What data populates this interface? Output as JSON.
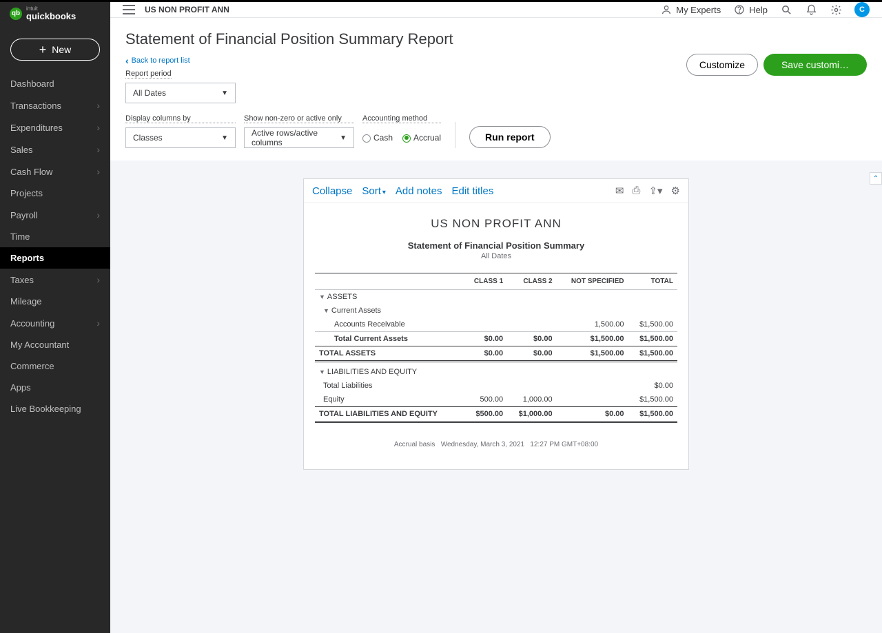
{
  "brand": {
    "intuit": "intuit",
    "product": "quickbooks",
    "logo_letter": "qb"
  },
  "new_button": "New",
  "nav": [
    {
      "label": "Dashboard",
      "chev": false
    },
    {
      "label": "Transactions",
      "chev": true
    },
    {
      "label": "Expenditures",
      "chev": true
    },
    {
      "label": "Sales",
      "chev": true
    },
    {
      "label": "Cash Flow",
      "chev": true
    },
    {
      "label": "Projects",
      "chev": false
    },
    {
      "label": "Payroll",
      "chev": true
    },
    {
      "label": "Time",
      "chev": false
    },
    {
      "label": "Reports",
      "chev": false,
      "active": true
    },
    {
      "label": "Taxes",
      "chev": true
    },
    {
      "label": "Mileage",
      "chev": false
    },
    {
      "label": "Accounting",
      "chev": true
    },
    {
      "label": "My Accountant",
      "chev": false
    },
    {
      "label": "Commerce",
      "chev": false
    },
    {
      "label": "Apps",
      "chev": false
    },
    {
      "label": "Live Bookkeeping",
      "chev": false
    }
  ],
  "topbar": {
    "company": "US NON PROFIT ANN",
    "my_experts": "My Experts",
    "help": "Help",
    "avatar_letter": "C"
  },
  "page": {
    "title": "Statement of Financial Position Summary Report",
    "back": "Back to report list",
    "customize": "Customize",
    "save_custom": "Save customi…"
  },
  "filters": {
    "period_label": "Report period",
    "period_value": "All Dates",
    "display_label": "Display columns by",
    "display_value": "Classes",
    "nonzero_label": "Show non-zero or active only",
    "nonzero_value": "Active rows/active columns",
    "method_label": "Accounting method",
    "cash": "Cash",
    "accrual": "Accrual",
    "run": "Run report"
  },
  "toolbar": {
    "collapse": "Collapse",
    "sort": "Sort",
    "add_notes": "Add notes",
    "edit_titles": "Edit titles"
  },
  "report": {
    "company": "US NON PROFIT ANN",
    "title": "Statement of Financial Position Summary",
    "subtitle": "All Dates",
    "cols": [
      "",
      "CLASS 1",
      "CLASS 2",
      "NOT SPECIFIED",
      "TOTAL"
    ],
    "sec_assets": "ASSETS",
    "sec_current": "Current Assets",
    "row_ar": {
      "label": "Accounts Receivable",
      "c1": "",
      "c2": "",
      "ns": "1,500.00",
      "t": "$1,500.00"
    },
    "row_tca": {
      "label": "Total Current Assets",
      "c1": "$0.00",
      "c2": "$0.00",
      "ns": "$1,500.00",
      "t": "$1,500.00"
    },
    "row_ta": {
      "label": "TOTAL ASSETS",
      "c1": "$0.00",
      "c2": "$0.00",
      "ns": "$1,500.00",
      "t": "$1,500.00"
    },
    "sec_liab": "LIABILITIES AND EQUITY",
    "row_tl": {
      "label": "Total Liabilities",
      "c1": "",
      "c2": "",
      "ns": "",
      "t": "$0.00"
    },
    "row_eq": {
      "label": "Equity",
      "c1": "500.00",
      "c2": "1,000.00",
      "ns": "",
      "t": "$1,500.00"
    },
    "row_tle": {
      "label": "TOTAL LIABILITIES AND EQUITY",
      "c1": "$500.00",
      "c2": "$1,000.00",
      "ns": "$0.00",
      "t": "$1,500.00"
    },
    "footer_basis": "Accrual basis",
    "footer_date": "Wednesday, March 3, 2021",
    "footer_time": "12:27 PM GMT+08:00"
  }
}
